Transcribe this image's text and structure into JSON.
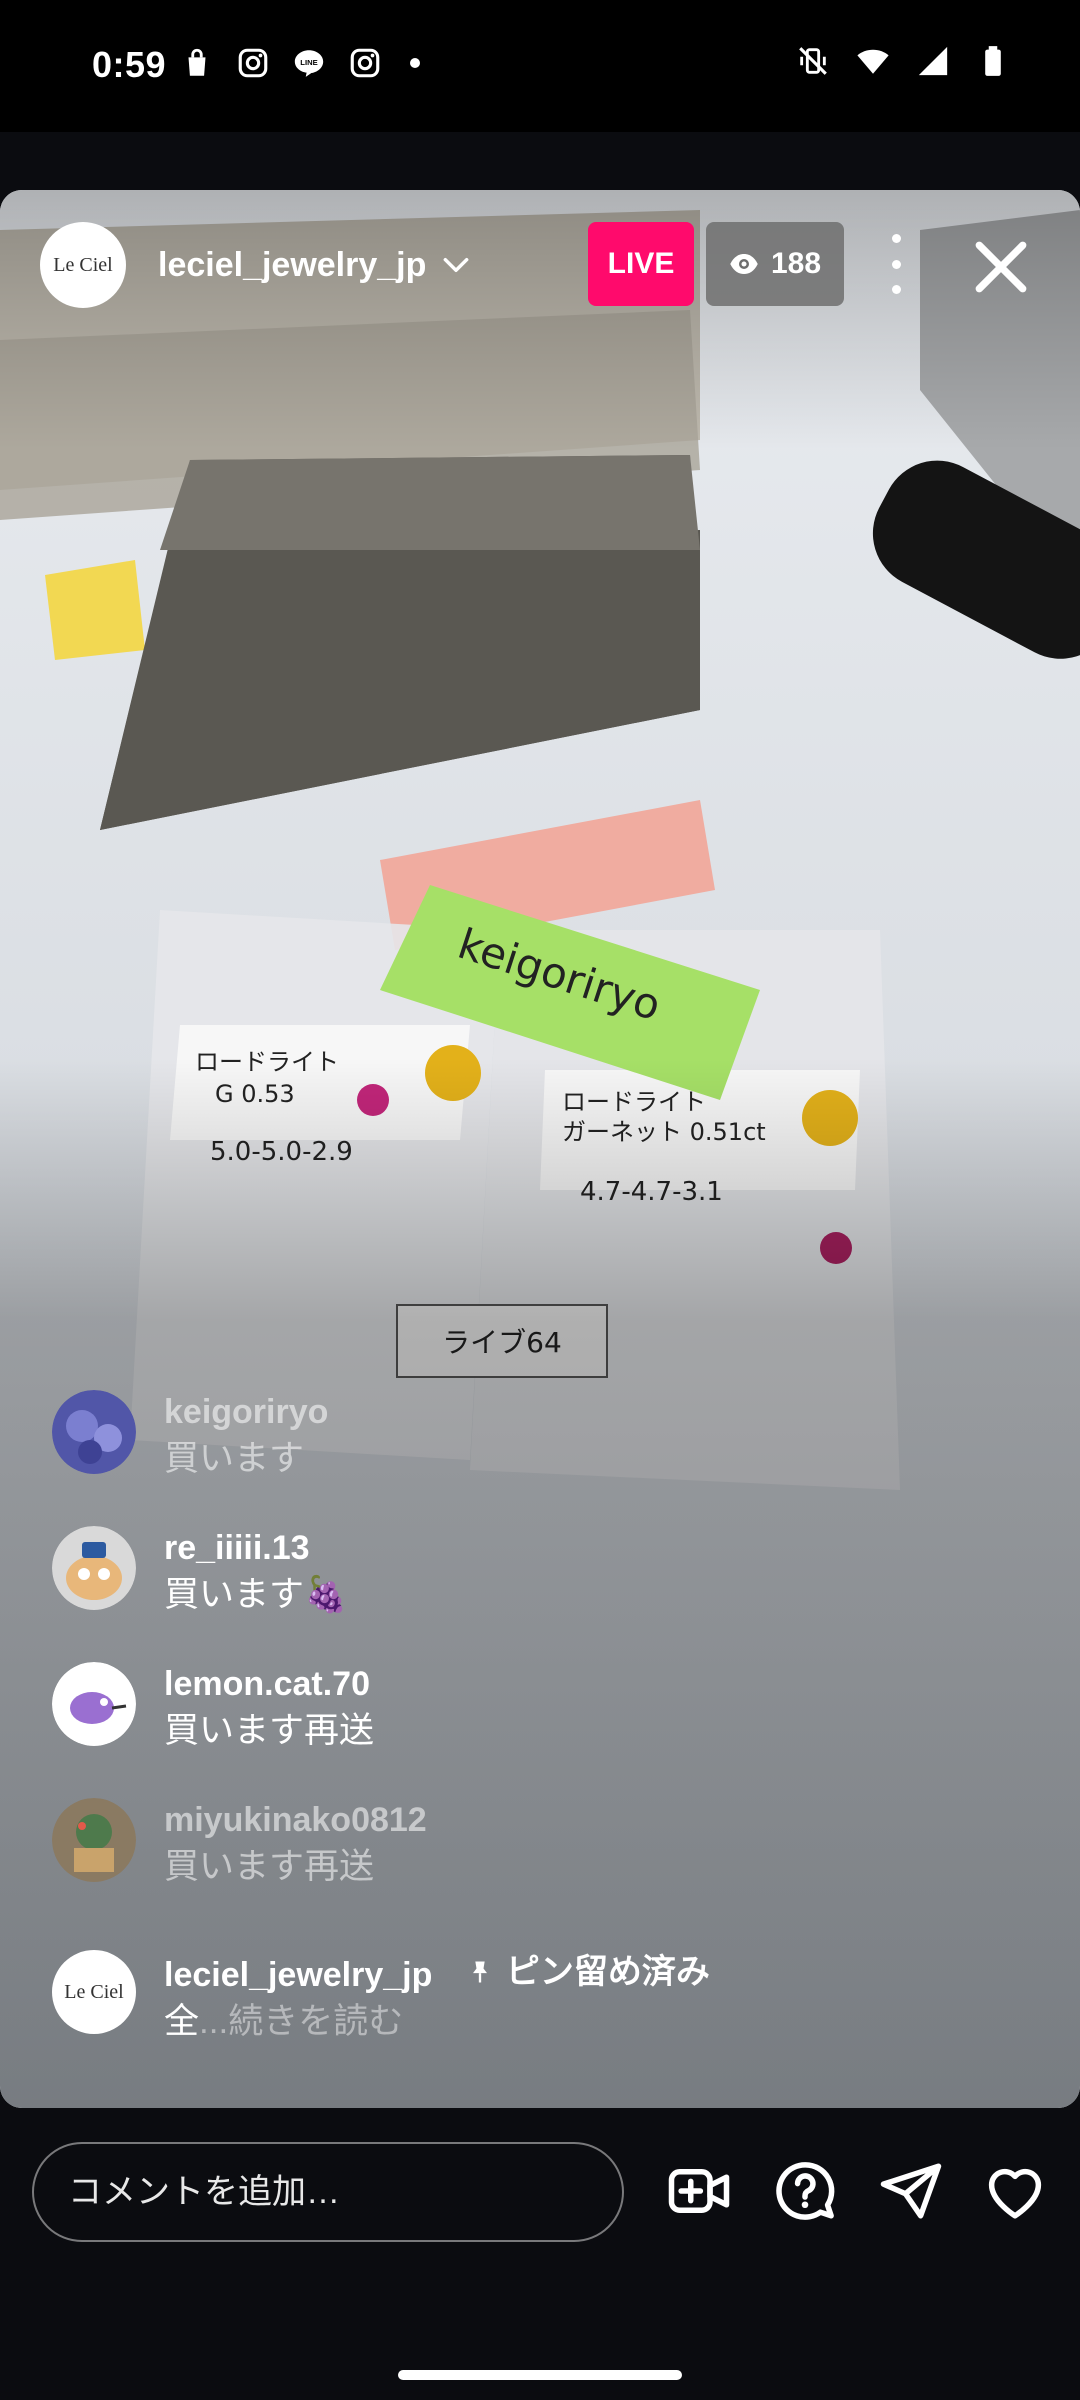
{
  "status_bar": {
    "time": "0:59",
    "left_icons": [
      "shopping-bag-icon",
      "instagram-icon",
      "line-icon",
      "instagram-icon",
      "notification-dot"
    ],
    "right_icons": [
      "vibrate-off-icon",
      "wifi-icon",
      "cellular-icon",
      "battery-icon"
    ]
  },
  "live": {
    "host_logo": "Le Ciel",
    "host_name": "leciel_jewelry_jp",
    "badge": "LIVE",
    "viewer_count": "188",
    "colors": {
      "live_badge": "#ff0a6c"
    }
  },
  "comments": [
    {
      "user": "keigoriryo",
      "message": "買います"
    },
    {
      "user": "re_iiiii.13",
      "message": "買います🍇"
    },
    {
      "user": "lemon.cat.70",
      "message": "買います再送"
    },
    {
      "user": "miyukinako0812",
      "message": "買います再送"
    }
  ],
  "pinned": {
    "user": "leciel_jewelry_jp",
    "avatar_logo": "Le Ciel",
    "pin_label": "ピン留め済み",
    "message": "全",
    "ellipsis": "...",
    "read_more": "続きを読む"
  },
  "bottom_bar": {
    "comment_placeholder": "コメントを追加…",
    "icons": [
      "add-video-guest-icon",
      "question-icon",
      "send-icon",
      "heart-icon"
    ]
  }
}
